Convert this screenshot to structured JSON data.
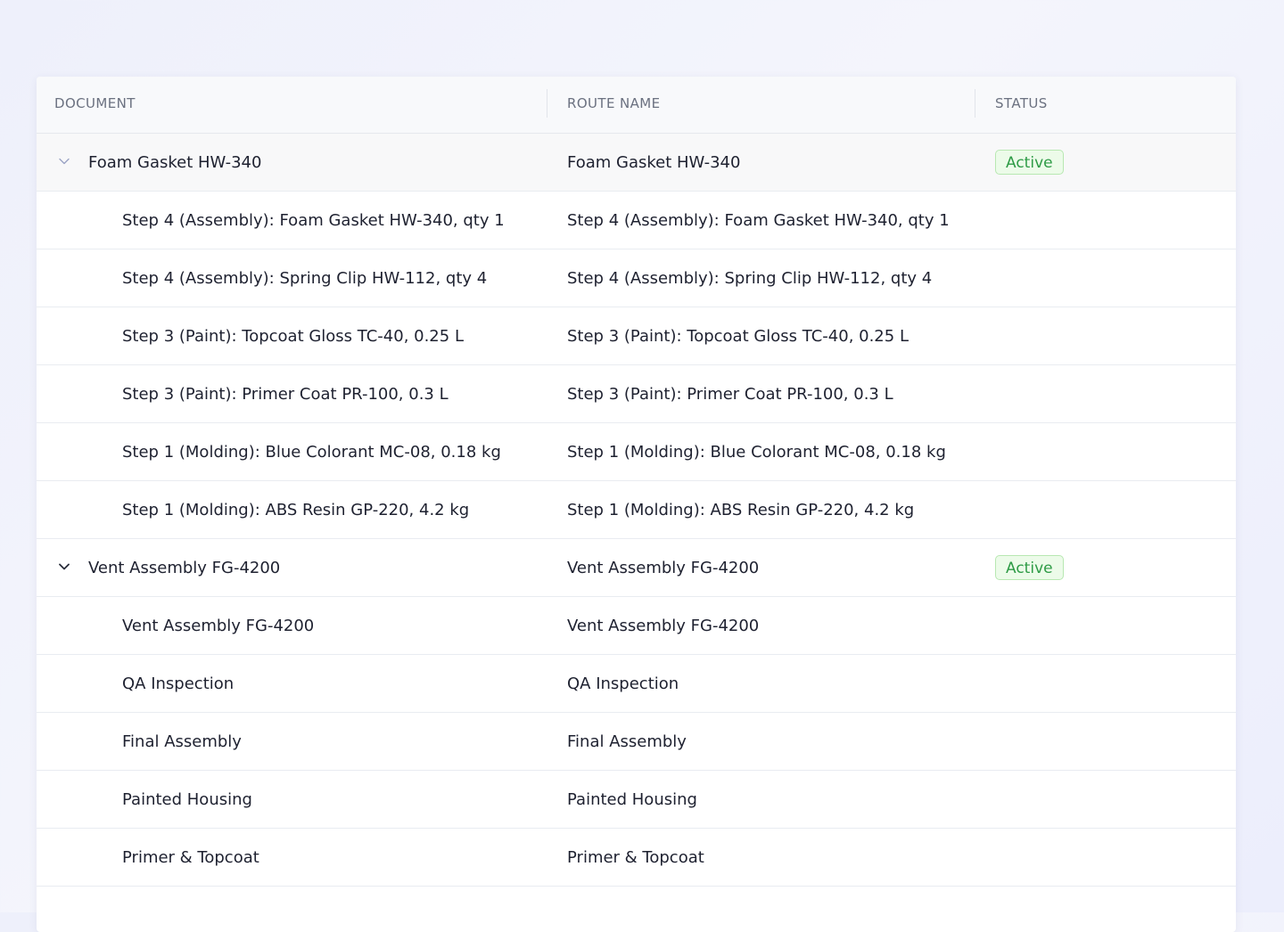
{
  "table": {
    "columns": [
      "DOCUMENT",
      "ROUTE NAME",
      "STATUS"
    ],
    "rows": [
      {
        "level": 0,
        "expand_icon": "chevron-down-icon",
        "document": "Foam Gasket HW-340",
        "route": "Foam Gasket HW-340",
        "status": "Active"
      },
      {
        "level": 1,
        "document": "Step 4 (Assembly): Foam Gasket HW-340, qty 1",
        "route": "Step 4 (Assembly): Foam Gasket HW-340, qty 1",
        "status": ""
      },
      {
        "level": 1,
        "document": "Step 4 (Assembly): Spring Clip HW-112, qty 4",
        "route": "Step 4 (Assembly): Spring Clip HW-112, qty 4",
        "status": ""
      },
      {
        "level": 1,
        "document": "Step 3 (Paint): Topcoat Gloss TC-40, 0.25 L",
        "route": "Step 3 (Paint): Topcoat Gloss TC-40, 0.25 L",
        "status": ""
      },
      {
        "level": 1,
        "document": "Step 3 (Paint): Primer Coat PR-100, 0.3 L",
        "route": "Step 3 (Paint): Primer Coat PR-100, 0.3 L",
        "status": ""
      },
      {
        "level": 1,
        "document": "Step 1 (Molding): Blue Colorant MC-08, 0.18 kg",
        "route": "Step 1 (Molding): Blue Colorant MC-08, 0.18 kg",
        "status": ""
      },
      {
        "level": 1,
        "document": "Step 1 (Molding): ABS Resin GP-220, 4.2 kg",
        "route": "Step 1 (Molding): ABS Resin GP-220, 4.2 kg",
        "status": ""
      },
      {
        "level": 0,
        "expand_icon": "chevron-down-icon",
        "document": "Vent Assembly FG-4200",
        "route": "Vent Assembly FG-4200",
        "status": "Active"
      },
      {
        "level": 1,
        "document": "Vent Assembly FG-4200",
        "route": "Vent Assembly FG-4200",
        "status": ""
      },
      {
        "level": 1,
        "document": "QA Inspection",
        "route": "QA Inspection",
        "status": ""
      },
      {
        "level": 1,
        "document": "Final Assembly",
        "route": "Final Assembly",
        "status": ""
      },
      {
        "level": 1,
        "document": "Painted Housing",
        "route": "Painted Housing",
        "status": ""
      },
      {
        "level": 1,
        "document": "Primer & Topcoat",
        "route": "Primer & Topcoat",
        "status": ""
      }
    ]
  },
  "colors": {
    "status_text": "#2e9b46",
    "status_bg": "#ecfbe9",
    "status_border": "#b8e8b2"
  }
}
